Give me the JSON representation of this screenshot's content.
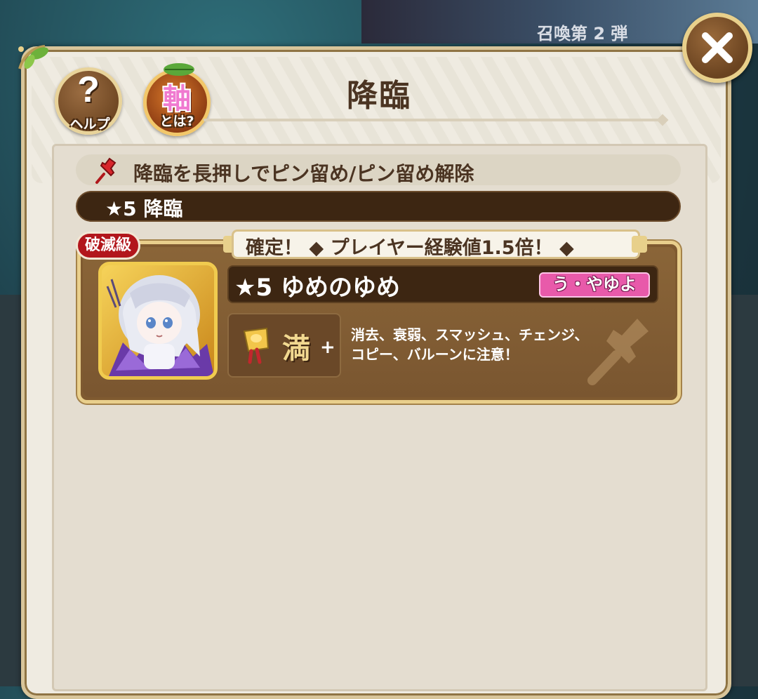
{
  "background": {
    "banner_text": "召喚第 2 弾"
  },
  "header": {
    "title": "降臨",
    "help_label": "ヘルプ",
    "help_symbol": "?",
    "axis_kanji": "軸",
    "axis_sub": "とは?",
    "close_symbol": "✕"
  },
  "pin_hint": {
    "text": "降臨を長押しでピン留め/ピン留め解除",
    "icon": "pushpin-icon"
  },
  "tier": {
    "label": "★5 降臨"
  },
  "quest_card": {
    "rank_badge": "破滅級",
    "bonus_text": "確定！ ◆ プレイヤー経験値1.5倍！ ◆",
    "name": "★5 ゆめのゆめ",
    "element_tag": "う・やゆよ",
    "luck_label": "満",
    "luck_plus": "+",
    "gimmick_line1": "消去、衰弱、スマッシュ、チェンジ、",
    "gimmick_line2": "コピー、バルーンに注意！"
  },
  "colors": {
    "panel_bg": "#efebe1",
    "panel_border": "#d8c59a",
    "dark_brown": "#3d2612",
    "rank_red": "#b2161c",
    "element_pink": "#e85aaa"
  }
}
